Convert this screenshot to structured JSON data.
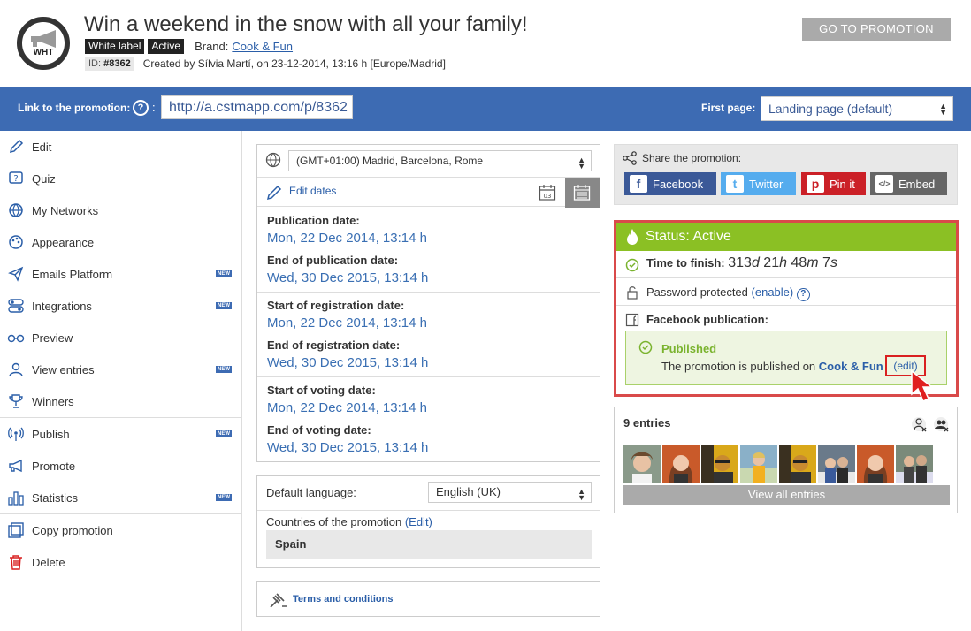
{
  "header": {
    "logo_text": "WHT",
    "title": "Win a weekend in the snow with all your family!",
    "tags": [
      "White label",
      "Active"
    ],
    "brand_label": "Brand:",
    "brand_name": "Cook & Fun",
    "id_label": "ID:",
    "id_value": "#8362",
    "created": "Created by Sílvia Martí, on 23-12-2014, 13:16 h [Europe/Madrid]",
    "goto_button": "GO TO PROMOTION"
  },
  "linkbar": {
    "label": "Link to the promotion:",
    "help": "?",
    "colon": ":",
    "url": "http://a.cstmapp.com/p/8362",
    "first_page_label": "First page:",
    "first_page_value": "Landing page (default)"
  },
  "sidebar": {
    "new_badge": "NEW",
    "items": [
      {
        "label": "Edit"
      },
      {
        "label": "Quiz"
      },
      {
        "label": "My Networks"
      },
      {
        "label": "Appearance"
      },
      {
        "label": "Emails Platform"
      },
      {
        "label": "Integrations"
      },
      {
        "label": "Preview"
      },
      {
        "label": "View entries"
      },
      {
        "label": "Winners"
      },
      {
        "label": "Publish"
      },
      {
        "label": "Promote"
      },
      {
        "label": "Statistics"
      },
      {
        "label": "Copy promotion"
      },
      {
        "label": "Delete"
      }
    ]
  },
  "dates": {
    "timezone": "(GMT+01:00) Madrid, Barcelona, Rome",
    "edit_dates": "Edit dates",
    "calendar_day": "03",
    "pub_start_label": "Publication date:",
    "pub_start": "Mon, 22 Dec 2014, 13:14 h",
    "pub_end_label": "End of publication date:",
    "pub_end": "Wed, 30 Dec 2015, 13:14 h",
    "reg_start_label": "Start of registration date:",
    "reg_start": "Mon, 22 Dec 2014, 13:14 h",
    "reg_end_label": "End of registration date:",
    "reg_end": "Wed, 30 Dec 2015, 13:14 h",
    "vote_start_label": "Start of voting date:",
    "vote_start": "Mon, 22 Dec 2014, 13:14 h",
    "vote_end_label": "End of voting date:",
    "vote_end": "Wed, 30 Dec 2015, 13:14 h"
  },
  "language": {
    "label": "Default language:",
    "value": "English (UK)",
    "countries_label": "Countries of the promotion",
    "countries_edit": "(Edit)",
    "country": "Spain"
  },
  "terms": {
    "label": "Terms and conditions"
  },
  "share": {
    "label": "Share the promotion:",
    "buttons": [
      {
        "label": "Facebook",
        "icon": "f",
        "color": "#3b5998"
      },
      {
        "label": "Twitter",
        "icon": "t",
        "color": "#55acee"
      },
      {
        "label": "Pin it",
        "icon": "p",
        "color": "#cb2027"
      },
      {
        "label": "Embed",
        "icon": "</>",
        "color": "#666666"
      }
    ]
  },
  "status": {
    "title": "Status: Active",
    "time_label": "Time to finish:",
    "time_value_d": "313",
    "time_unit_d": "d",
    "time_value_h": "21",
    "time_unit_h": "h",
    "time_value_m": "48",
    "time_unit_m": "m",
    "time_value_s": "7",
    "time_unit_s": "s",
    "password_label": "Password protected",
    "password_enable": "(enable)",
    "fb_label": "Facebook publication:",
    "published_title": "Published",
    "published_text": "The promotion is published on",
    "published_brand": "Cook & Fun",
    "published_edit": "(edit)"
  },
  "entries": {
    "label": "9 entries",
    "view_all": "View all entries",
    "count": 9
  },
  "colors": {
    "blue_bar": "#3d6bb3",
    "status_green": "#8bc024",
    "highlight_red": "#d94a4a"
  }
}
